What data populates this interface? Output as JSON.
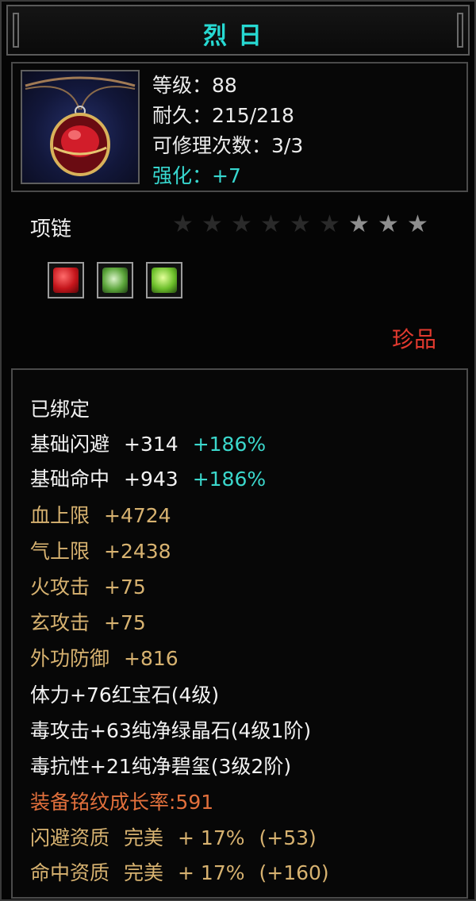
{
  "title": "烈日",
  "header": {
    "level_label": "等级：88",
    "durability_label": "耐久：215/218",
    "repair_label": "可修理次数：3/3",
    "strengthen_label": "强化：+7"
  },
  "item_type": "项链",
  "stars": {
    "total": 9,
    "dim": 6,
    "lit": 3
  },
  "gems": [
    {
      "name": "red-gem-icon",
      "color": "#c4151b"
    },
    {
      "name": "green-crystal-icon",
      "color": "#5ba53a"
    },
    {
      "name": "green-jade-icon",
      "color": "#6cbf2a"
    }
  ],
  "quality": "珍品",
  "attributes": {
    "bound": "已绑定",
    "dodge": {
      "label": "基础闪避",
      "value": "+314",
      "pct": "+186%"
    },
    "hit": {
      "label": "基础命中",
      "value": "+943",
      "pct": "+186%"
    },
    "hp": {
      "label": "血上限",
      "value": "+4724"
    },
    "qi": {
      "label": "气上限",
      "value": "+2438"
    },
    "fire": {
      "label": "火攻击",
      "value": "+75"
    },
    "xuan": {
      "label": "玄攻击",
      "value": "+75"
    },
    "def": {
      "label": "外功防御",
      "value": "+816"
    },
    "gem1": "体力+76红宝石(4级)",
    "gem2": "毒攻击+63纯净绿晶石(4级1阶)",
    "gem3": "毒抗性+21纯净碧玺(3级2阶)",
    "growth": "装备铭纹成长率:591",
    "dodge_q": {
      "label": "闪避资质",
      "grade": "完美",
      "value": "+ 17%",
      "bonus": "(+53)"
    },
    "hit_q": {
      "label": "命中资质",
      "grade": "完美",
      "value": "+ 17%",
      "bonus": "(+160)"
    }
  }
}
